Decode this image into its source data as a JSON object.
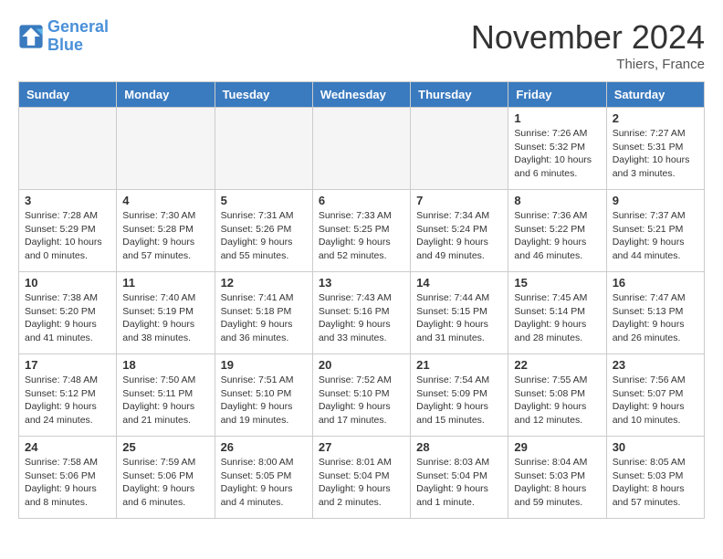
{
  "header": {
    "logo_line1": "General",
    "logo_line2": "Blue",
    "month": "November 2024",
    "location": "Thiers, France"
  },
  "weekdays": [
    "Sunday",
    "Monday",
    "Tuesday",
    "Wednesday",
    "Thursday",
    "Friday",
    "Saturday"
  ],
  "weeks": [
    [
      {
        "num": "",
        "info": ""
      },
      {
        "num": "",
        "info": ""
      },
      {
        "num": "",
        "info": ""
      },
      {
        "num": "",
        "info": ""
      },
      {
        "num": "",
        "info": ""
      },
      {
        "num": "1",
        "info": "Sunrise: 7:26 AM\nSunset: 5:32 PM\nDaylight: 10 hours\nand 6 minutes."
      },
      {
        "num": "2",
        "info": "Sunrise: 7:27 AM\nSunset: 5:31 PM\nDaylight: 10 hours\nand 3 minutes."
      }
    ],
    [
      {
        "num": "3",
        "info": "Sunrise: 7:28 AM\nSunset: 5:29 PM\nDaylight: 10 hours\nand 0 minutes."
      },
      {
        "num": "4",
        "info": "Sunrise: 7:30 AM\nSunset: 5:28 PM\nDaylight: 9 hours\nand 57 minutes."
      },
      {
        "num": "5",
        "info": "Sunrise: 7:31 AM\nSunset: 5:26 PM\nDaylight: 9 hours\nand 55 minutes."
      },
      {
        "num": "6",
        "info": "Sunrise: 7:33 AM\nSunset: 5:25 PM\nDaylight: 9 hours\nand 52 minutes."
      },
      {
        "num": "7",
        "info": "Sunrise: 7:34 AM\nSunset: 5:24 PM\nDaylight: 9 hours\nand 49 minutes."
      },
      {
        "num": "8",
        "info": "Sunrise: 7:36 AM\nSunset: 5:22 PM\nDaylight: 9 hours\nand 46 minutes."
      },
      {
        "num": "9",
        "info": "Sunrise: 7:37 AM\nSunset: 5:21 PM\nDaylight: 9 hours\nand 44 minutes."
      }
    ],
    [
      {
        "num": "10",
        "info": "Sunrise: 7:38 AM\nSunset: 5:20 PM\nDaylight: 9 hours\nand 41 minutes."
      },
      {
        "num": "11",
        "info": "Sunrise: 7:40 AM\nSunset: 5:19 PM\nDaylight: 9 hours\nand 38 minutes."
      },
      {
        "num": "12",
        "info": "Sunrise: 7:41 AM\nSunset: 5:18 PM\nDaylight: 9 hours\nand 36 minutes."
      },
      {
        "num": "13",
        "info": "Sunrise: 7:43 AM\nSunset: 5:16 PM\nDaylight: 9 hours\nand 33 minutes."
      },
      {
        "num": "14",
        "info": "Sunrise: 7:44 AM\nSunset: 5:15 PM\nDaylight: 9 hours\nand 31 minutes."
      },
      {
        "num": "15",
        "info": "Sunrise: 7:45 AM\nSunset: 5:14 PM\nDaylight: 9 hours\nand 28 minutes."
      },
      {
        "num": "16",
        "info": "Sunrise: 7:47 AM\nSunset: 5:13 PM\nDaylight: 9 hours\nand 26 minutes."
      }
    ],
    [
      {
        "num": "17",
        "info": "Sunrise: 7:48 AM\nSunset: 5:12 PM\nDaylight: 9 hours\nand 24 minutes."
      },
      {
        "num": "18",
        "info": "Sunrise: 7:50 AM\nSunset: 5:11 PM\nDaylight: 9 hours\nand 21 minutes."
      },
      {
        "num": "19",
        "info": "Sunrise: 7:51 AM\nSunset: 5:10 PM\nDaylight: 9 hours\nand 19 minutes."
      },
      {
        "num": "20",
        "info": "Sunrise: 7:52 AM\nSunset: 5:10 PM\nDaylight: 9 hours\nand 17 minutes."
      },
      {
        "num": "21",
        "info": "Sunrise: 7:54 AM\nSunset: 5:09 PM\nDaylight: 9 hours\nand 15 minutes."
      },
      {
        "num": "22",
        "info": "Sunrise: 7:55 AM\nSunset: 5:08 PM\nDaylight: 9 hours\nand 12 minutes."
      },
      {
        "num": "23",
        "info": "Sunrise: 7:56 AM\nSunset: 5:07 PM\nDaylight: 9 hours\nand 10 minutes."
      }
    ],
    [
      {
        "num": "24",
        "info": "Sunrise: 7:58 AM\nSunset: 5:06 PM\nDaylight: 9 hours\nand 8 minutes."
      },
      {
        "num": "25",
        "info": "Sunrise: 7:59 AM\nSunset: 5:06 PM\nDaylight: 9 hours\nand 6 minutes."
      },
      {
        "num": "26",
        "info": "Sunrise: 8:00 AM\nSunset: 5:05 PM\nDaylight: 9 hours\nand 4 minutes."
      },
      {
        "num": "27",
        "info": "Sunrise: 8:01 AM\nSunset: 5:04 PM\nDaylight: 9 hours\nand 2 minutes."
      },
      {
        "num": "28",
        "info": "Sunrise: 8:03 AM\nSunset: 5:04 PM\nDaylight: 9 hours\nand 1 minute."
      },
      {
        "num": "29",
        "info": "Sunrise: 8:04 AM\nSunset: 5:03 PM\nDaylight: 8 hours\nand 59 minutes."
      },
      {
        "num": "30",
        "info": "Sunrise: 8:05 AM\nSunset: 5:03 PM\nDaylight: 8 hours\nand 57 minutes."
      }
    ]
  ]
}
